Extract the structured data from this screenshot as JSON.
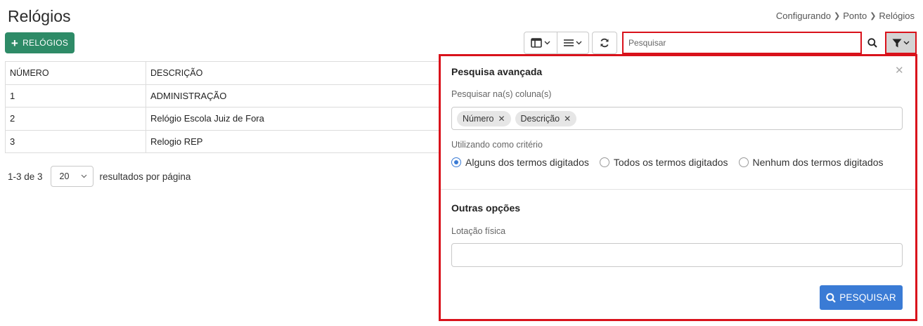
{
  "page": {
    "title": "Relógios"
  },
  "breadcrumb": {
    "items": [
      "Configurando",
      "Ponto",
      "Relógios"
    ]
  },
  "toolbar": {
    "add_label": "RELÓGIOS",
    "search_placeholder": "Pesquisar",
    "icons": [
      "columns-icon",
      "list-icon",
      "refresh-icon",
      "search-icon",
      "filter-icon"
    ]
  },
  "table": {
    "headers": [
      "NÚMERO",
      "DESCRIÇÃO"
    ],
    "rows": [
      [
        "1",
        "ADMINISTRAÇÃO"
      ],
      [
        "2",
        "Relógio Escola Juiz de Fora"
      ],
      [
        "3",
        "Relogio REP"
      ]
    ]
  },
  "pager": {
    "range": "1-3 de 3",
    "page_size": "20",
    "suffix": "resultados por página"
  },
  "advanced": {
    "title": "Pesquisa avançada",
    "columns_label": "Pesquisar na(s) coluna(s)",
    "chips": [
      "Número",
      "Descrição"
    ],
    "criteria_label": "Utilizando como critério",
    "criteria": [
      {
        "label": "Alguns dos termos digitados",
        "checked": true
      },
      {
        "label": "Todos os termos digitados",
        "checked": false
      },
      {
        "label": "Nenhum dos termos digitados",
        "checked": false
      }
    ],
    "other_title": "Outras opções",
    "lotacao_label": "Lotação física",
    "lotacao_value": "",
    "submit_label": "PESQUISAR"
  },
  "colors": {
    "accent_green": "#2e8b67",
    "accent_blue": "#3a7bd5",
    "highlight_red": "#d9121b"
  }
}
